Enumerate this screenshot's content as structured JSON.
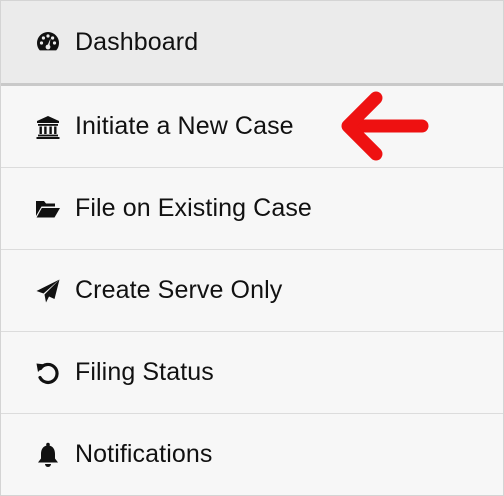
{
  "nav": {
    "items": [
      {
        "label": "Dashboard",
        "icon": "dashboard-icon",
        "active": true
      },
      {
        "label": "Initiate a New Case",
        "icon": "bank-icon",
        "active": false
      },
      {
        "label": "File on Existing Case",
        "icon": "folder-open-icon",
        "active": false
      },
      {
        "label": "Create Serve Only",
        "icon": "paper-plane-icon",
        "active": false
      },
      {
        "label": "Filing Status",
        "icon": "undo-icon",
        "active": false
      },
      {
        "label": "Notifications",
        "icon": "bell-icon",
        "active": false
      }
    ]
  },
  "annotation": {
    "arrow_icon": "red-arrow-icon",
    "arrow_color": "#ee1111",
    "points_to": "Initiate a New Case"
  },
  "colors": {
    "background": "#f7f7f7",
    "active_background": "#ebebeb",
    "text": "#111111",
    "divider": "#dcdcdc"
  }
}
